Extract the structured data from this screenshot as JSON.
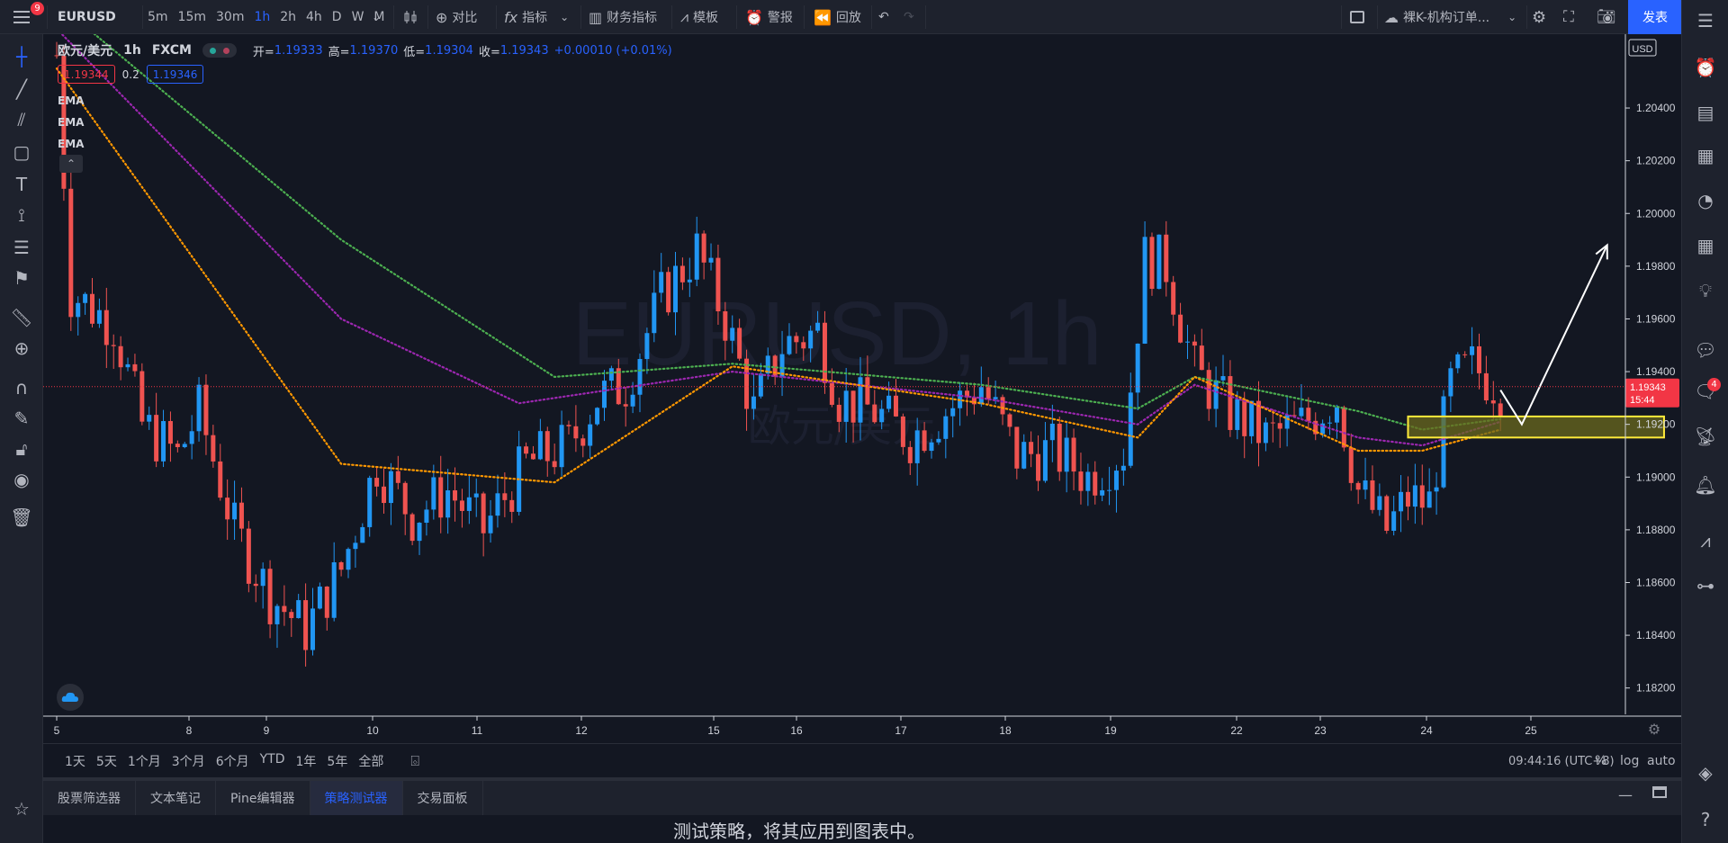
{
  "toolbar": {
    "notification_count": "9",
    "symbol": "EURUSD",
    "intervals": [
      "5m",
      "15m",
      "30m",
      "1h",
      "2h",
      "4h",
      "D",
      "W",
      "M"
    ],
    "active_interval": "1h",
    "compare_label": "对比",
    "indicators_label": "指标",
    "financials_label": "财务指标",
    "templates_label": "模板",
    "alerts_label": "警报",
    "replay_label": "回放",
    "layout_name": "裸K-机构订单...",
    "publish_label": "发表"
  },
  "legend": {
    "title": "欧元/美元",
    "interval": "1h",
    "source": "FXCM",
    "open_label": "开=",
    "open": "1.19333",
    "high_label": "高=",
    "high": "1.19370",
    "low_label": "低=",
    "low": "1.19304",
    "close_label": "收=",
    "close": "1.19343",
    "change": "+0.00010 (+0.01%)",
    "bid": "1.19344",
    "spread": "0.2",
    "ask": "1.19346",
    "indicators": [
      "EMA",
      "EMA",
      "EMA"
    ]
  },
  "watermark": {
    "symbol": "EURUSD, 1h",
    "name": "欧元/美元"
  },
  "colors": {
    "up": "#2196f3",
    "down": "#ef5350",
    "ema_fast": "#ff9800",
    "ema_mid": "#9c27b0",
    "ema_slow": "#4caf50",
    "zone_fill": "#6b6a1e",
    "zone_border": "#ffeb3b",
    "price_line": "#f23645",
    "background": "#131722"
  },
  "chart_data": {
    "type": "candlestick",
    "currency": "USD",
    "ylim": [
      1.181,
      1.2068
    ],
    "y_ticks": [
      "1.20400",
      "1.20200",
      "1.20000",
      "1.19800",
      "1.19600",
      "1.19400",
      "1.19200",
      "1.19000",
      "1.18800",
      "1.18600",
      "1.18400",
      "1.18200"
    ],
    "x_ticks": [
      "5",
      "8",
      "9",
      "10",
      "11",
      "12",
      "15",
      "16",
      "17",
      "18",
      "19",
      "22",
      "23",
      "24",
      "25"
    ],
    "last_price": "1.19343",
    "countdown": "15:44",
    "price_path": [
      [
        0,
        1.206
      ],
      [
        2,
        1.197
      ],
      [
        8,
        1.1958
      ],
      [
        12,
        1.192
      ],
      [
        17,
        1.1908
      ],
      [
        20,
        1.1925
      ],
      [
        25,
        1.188
      ],
      [
        30,
        1.1855
      ],
      [
        35,
        1.1842
      ],
      [
        40,
        1.1865
      ],
      [
        45,
        1.1905
      ],
      [
        50,
        1.1885
      ],
      [
        55,
        1.1895
      ],
      [
        60,
        1.188
      ],
      [
        66,
        1.1905
      ],
      [
        72,
        1.1912
      ],
      [
        76,
        1.193
      ],
      [
        80,
        1.1935
      ],
      [
        85,
        1.1968
      ],
      [
        90,
        1.1986
      ],
      [
        94,
        1.196
      ],
      [
        98,
        1.1925
      ],
      [
        102,
        1.195
      ],
      [
        107,
        1.1955
      ],
      [
        110,
        1.193
      ],
      [
        115,
        1.1925
      ],
      [
        120,
        1.1915
      ],
      [
        125,
        1.1925
      ],
      [
        130,
        1.1935
      ],
      [
        135,
        1.1908
      ],
      [
        140,
        1.191
      ],
      [
        145,
        1.19
      ],
      [
        150,
        1.191
      ],
      [
        153,
        1.1983
      ],
      [
        156,
        1.198
      ],
      [
        160,
        1.194
      ],
      [
        165,
        1.1925
      ],
      [
        170,
        1.1915
      ],
      [
        175,
        1.192
      ],
      [
        180,
        1.193
      ],
      [
        183,
        1.1895
      ],
      [
        187,
        1.188
      ],
      [
        190,
        1.1892
      ],
      [
        193,
        1.189
      ],
      [
        196,
        1.1935
      ],
      [
        199,
        1.1942
      ],
      [
        203,
        1.1934
      ]
    ],
    "ema_fast": [
      [
        0,
        1.2055
      ],
      [
        40,
        1.1905
      ],
      [
        70,
        1.1898
      ],
      [
        95,
        1.1942
      ],
      [
        130,
        1.1928
      ],
      [
        152,
        1.1915
      ],
      [
        160,
        1.1938
      ],
      [
        183,
        1.191
      ],
      [
        192,
        1.191
      ],
      [
        203,
        1.1918
      ]
    ],
    "ema_mid": [
      [
        0,
        1.207
      ],
      [
        40,
        1.196
      ],
      [
        65,
        1.1928
      ],
      [
        95,
        1.194
      ],
      [
        130,
        1.193
      ],
      [
        152,
        1.192
      ],
      [
        160,
        1.1935
      ],
      [
        183,
        1.1915
      ],
      [
        192,
        1.1912
      ],
      [
        203,
        1.1921
      ]
    ],
    "ema_slow": [
      [
        0,
        1.208
      ],
      [
        40,
        1.199
      ],
      [
        70,
        1.1938
      ],
      [
        95,
        1.1943
      ],
      [
        130,
        1.1935
      ],
      [
        152,
        1.1926
      ],
      [
        160,
        1.1938
      ],
      [
        183,
        1.1925
      ],
      [
        192,
        1.1918
      ],
      [
        203,
        1.1922
      ]
    ],
    "zone": {
      "y_top": 1.1923,
      "y_bottom": 1.1915,
      "x_start": 190,
      "x_end": 226
    },
    "projection_arrow": [
      [
        203,
        1.1933
      ],
      [
        206,
        1.192
      ],
      [
        218,
        1.1988
      ]
    ]
  },
  "range_bar": {
    "ranges": [
      "1天",
      "5天",
      "1个月",
      "3个月",
      "6个月",
      "YTD",
      "1年",
      "5年",
      "全部"
    ],
    "clock": "09:44:16 (UTC+8)",
    "percent": "%",
    "log": "log",
    "auto": "auto"
  },
  "panel": {
    "tabs": [
      "股票筛选器",
      "文本笔记",
      "Pine编辑器",
      "策略测试器",
      "交易面板"
    ],
    "active_tab": "策略测试器",
    "message": "测试策略，将其应用到图表中。"
  },
  "right_toolbar": {
    "badge_count": "4"
  }
}
